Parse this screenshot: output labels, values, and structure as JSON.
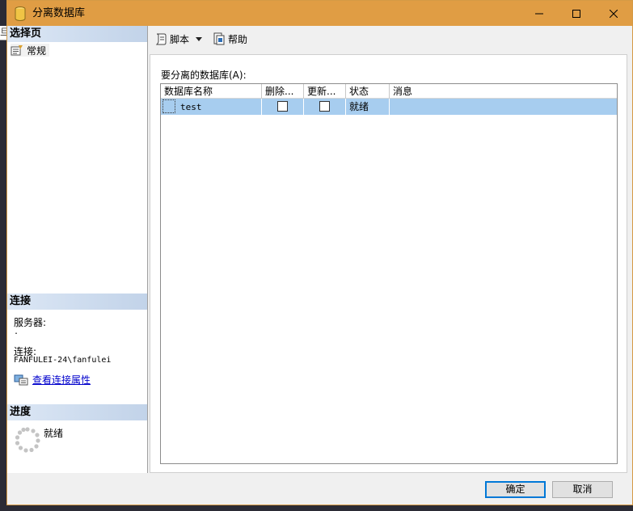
{
  "window": {
    "title": "分离数据库",
    "controls": {
      "minimize": "—",
      "maximize": "☐",
      "close": "✕"
    }
  },
  "behind": {
    "fragment": "旦"
  },
  "left_pane": {
    "select_page_header": "选择页",
    "pages": [
      {
        "label": "常规",
        "icon": "general-page-icon"
      }
    ],
    "connection_header": "连接",
    "server_label": "服务器:",
    "server_value": ".",
    "connection_label": "连接:",
    "connection_value": "FANFULEI-24\\fanfulei",
    "view_properties_link": "查看连接属性",
    "progress_header": "进度",
    "progress_status": "就绪"
  },
  "toolbar": {
    "script_label": "脚本",
    "help_label": "帮助"
  },
  "main": {
    "databases_label": "要分离的数据库(A):",
    "columns": [
      "数据库名称",
      "删除...",
      "更新...",
      "状态",
      "消息"
    ],
    "rows": [
      {
        "name": "test",
        "drop": false,
        "update": false,
        "status": "就绪",
        "message": ""
      }
    ]
  },
  "buttons": {
    "ok": "确定",
    "cancel": "取消"
  },
  "colors": {
    "titlebar": "#e09d44",
    "selected_row": "#a7cdef",
    "link": "#0000cc",
    "default_button_border": "#0078d7"
  }
}
